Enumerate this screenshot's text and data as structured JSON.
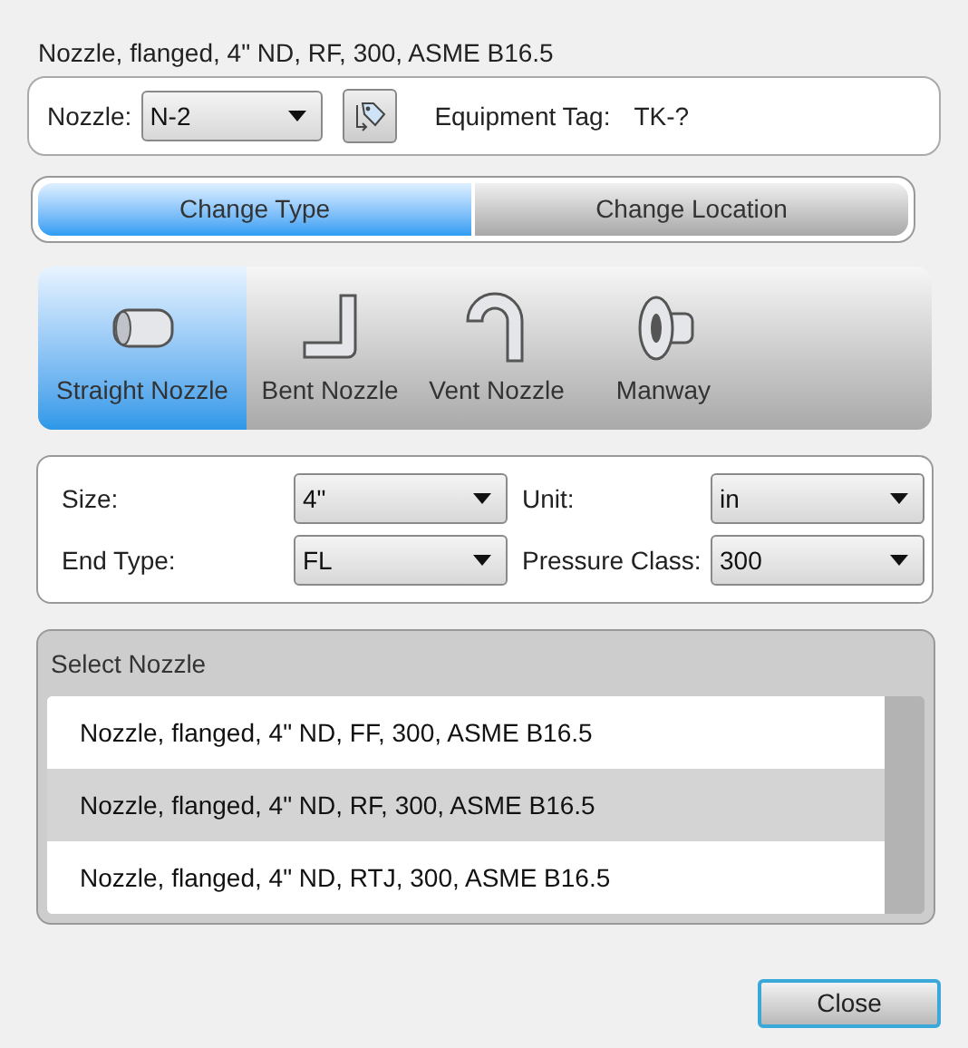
{
  "title": "Nozzle, flanged, 4\" ND, RF, 300, ASME B16.5",
  "nozzle": {
    "label": "Nozzle:",
    "value": "N-2",
    "equipment_tag_label": "Equipment Tag:",
    "equipment_tag": "TK-?"
  },
  "mode_tabs": [
    {
      "label": "Change Type",
      "selected": true
    },
    {
      "label": "Change Location",
      "selected": false
    }
  ],
  "nozzle_types": [
    {
      "kind": "straight",
      "label": "Straight Nozzle",
      "selected": true
    },
    {
      "kind": "bent",
      "label": "Bent Nozzle",
      "selected": false
    },
    {
      "kind": "vent",
      "label": "Vent Nozzle",
      "selected": false
    },
    {
      "kind": "manway",
      "label": "Manway",
      "selected": false
    }
  ],
  "settings": [
    {
      "label": "Size:",
      "value": "4\""
    },
    {
      "label": "Unit:",
      "value": "in"
    },
    {
      "label": "End Type:",
      "value": "FL"
    },
    {
      "label": "Pressure Class:",
      "value": "300"
    }
  ],
  "select_nozzle": {
    "title": "Select Nozzle",
    "items": [
      {
        "label": "Nozzle, flanged, 4\" ND, FF, 300, ASME B16.5",
        "selected": false
      },
      {
        "label": "Nozzle, flanged, 4\" ND, RF, 300, ASME B16.5",
        "selected": true
      },
      {
        "label": "Nozzle, flanged, 4\" ND, RTJ, 300, ASME B16.5",
        "selected": false
      }
    ]
  },
  "buttons": [
    {
      "label": "Close"
    }
  ]
}
